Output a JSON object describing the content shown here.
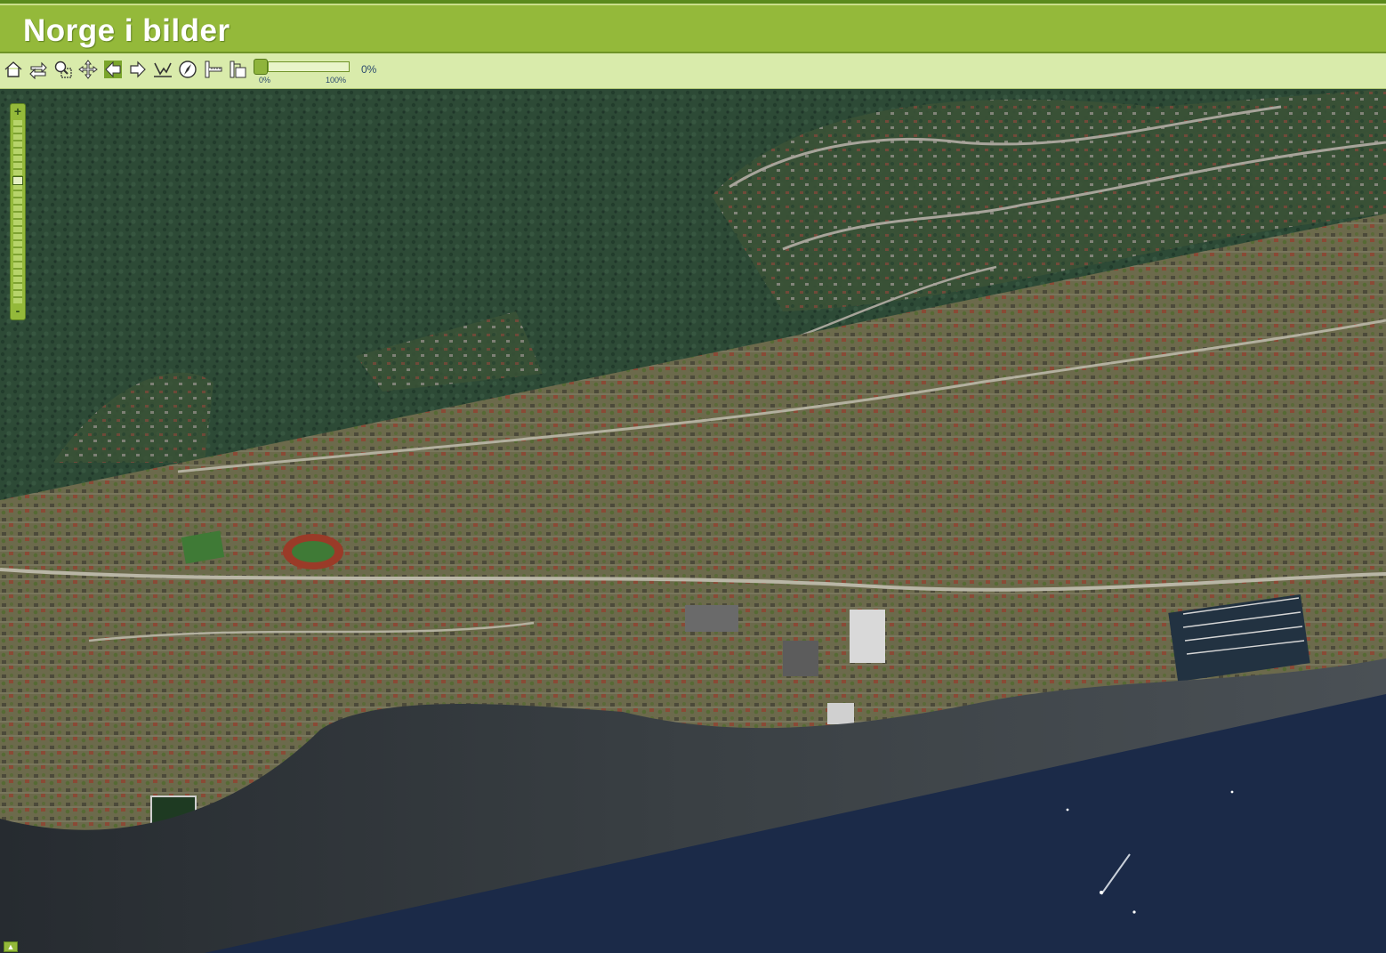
{
  "app": {
    "title": "Norge i bilder"
  },
  "toolbar": {
    "tools": [
      {
        "icon": "home-icon"
      },
      {
        "icon": "swap-icon"
      },
      {
        "icon": "zoom-box-icon"
      },
      {
        "icon": "pan-icon"
      },
      {
        "icon": "back-arrow-icon"
      },
      {
        "icon": "forward-arrow-icon"
      },
      {
        "icon": "profile-icon"
      },
      {
        "icon": "compass-icon"
      },
      {
        "icon": "measure-line-icon"
      },
      {
        "icon": "measure-area-icon"
      }
    ],
    "transparency": {
      "min_label": "0%",
      "max_label": "100%",
      "value_label": "0%",
      "value": 0
    }
  },
  "map": {
    "zoom_in_label": "+",
    "zoom_out_label": "-",
    "zoom_level_fraction": 0.32,
    "colors": {
      "forest": "#2c4a38",
      "urban": "#6e6a4f",
      "water": "#1b2a48",
      "water_light": "#3b4146",
      "header_green": "#94b93a",
      "toolbar_green": "#d9ebab"
    }
  }
}
